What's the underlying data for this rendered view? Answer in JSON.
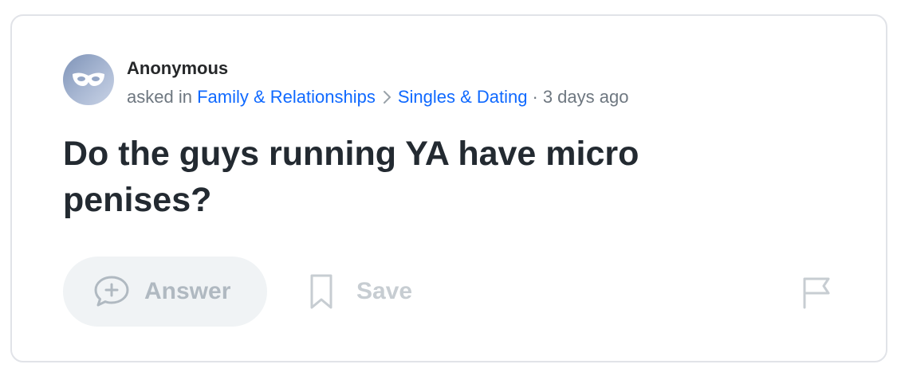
{
  "question": {
    "author": "Anonymous",
    "asked_in_prefix": "asked in",
    "category": "Family & Relationships",
    "subcategory": "Singles & Dating",
    "separator": "·",
    "time_ago": "3 days ago",
    "title": "Do the guys running YA have micro penises?"
  },
  "actions": {
    "answer_label": "Answer",
    "save_label": "Save"
  },
  "icons": {
    "avatar": "anonymous-mask-icon",
    "breadcrumb_separator": "chevron-right-icon",
    "answer": "plus-speech-bubble-icon",
    "save": "bookmark-icon",
    "report": "flag-icon"
  },
  "colors": {
    "link": "#0f69ff",
    "meta_text": "#6e7780",
    "title_text": "#232a31",
    "disabled_text": "#b0b9c1",
    "answer_bg": "#f0f3f5",
    "card_border": "#e1e3e8"
  }
}
